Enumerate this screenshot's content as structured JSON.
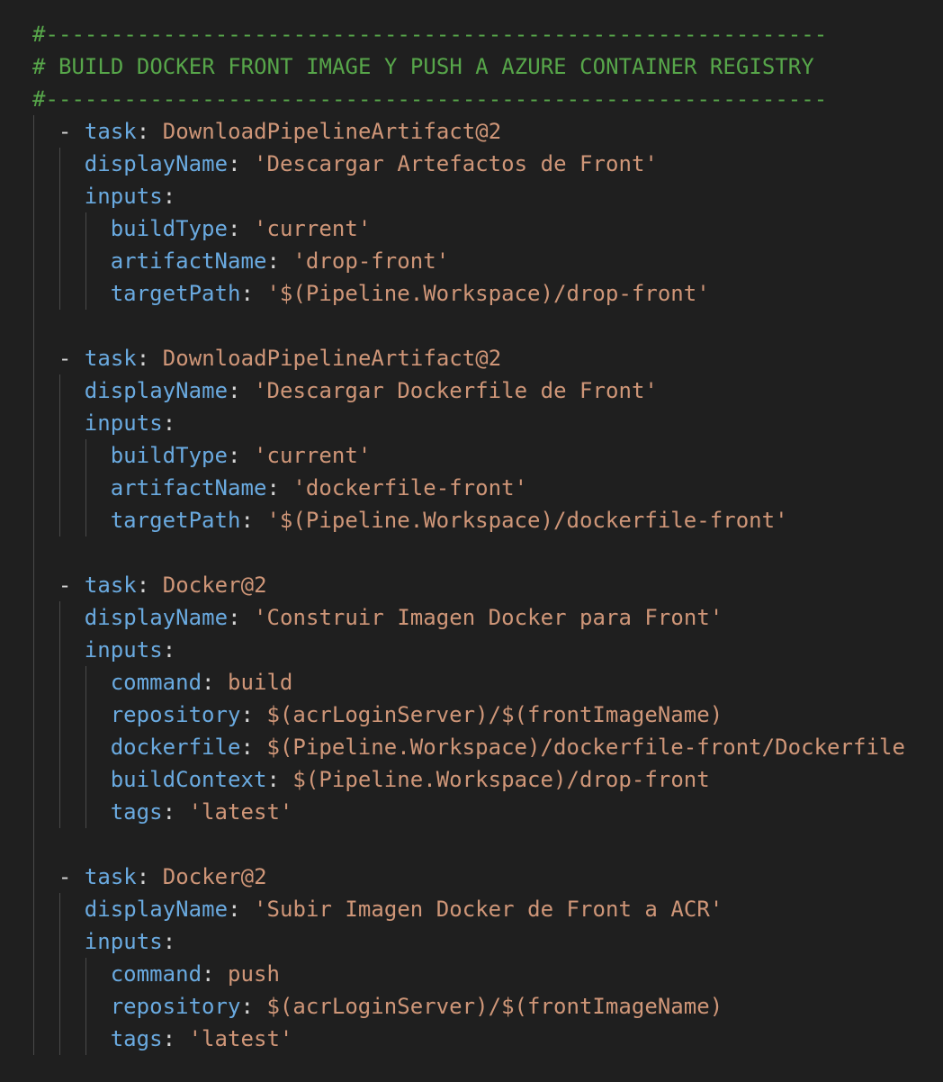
{
  "code": {
    "language": "yaml",
    "lines": [
      {
        "indent": 0,
        "tokens": [
          {
            "t": "#------------------------------------------------------------",
            "c": "cmt"
          }
        ]
      },
      {
        "indent": 0,
        "tokens": [
          {
            "t": "# BUILD DOCKER FRONT IMAGE Y PUSH A AZURE CONTAINER REGISTRY",
            "c": "cmt"
          }
        ]
      },
      {
        "indent": 0,
        "tokens": [
          {
            "t": "#------------------------------------------------------------",
            "c": "cmt"
          }
        ]
      },
      {
        "indent": 2,
        "tokens": [
          {
            "t": "- ",
            "c": "pun"
          },
          {
            "t": "task",
            "c": "key"
          },
          {
            "t": ": ",
            "c": "pun"
          },
          {
            "t": "DownloadPipelineArtifact@2",
            "c": "str"
          }
        ]
      },
      {
        "indent": 4,
        "tokens": [
          {
            "t": "displayName",
            "c": "key"
          },
          {
            "t": ": ",
            "c": "pun"
          },
          {
            "t": "'Descargar Artefactos de Front'",
            "c": "str"
          }
        ]
      },
      {
        "indent": 4,
        "tokens": [
          {
            "t": "inputs",
            "c": "key"
          },
          {
            "t": ":",
            "c": "pun"
          }
        ]
      },
      {
        "indent": 6,
        "tokens": [
          {
            "t": "buildType",
            "c": "key"
          },
          {
            "t": ": ",
            "c": "pun"
          },
          {
            "t": "'current'",
            "c": "str"
          }
        ]
      },
      {
        "indent": 6,
        "tokens": [
          {
            "t": "artifactName",
            "c": "key"
          },
          {
            "t": ": ",
            "c": "pun"
          },
          {
            "t": "'drop-front'",
            "c": "str"
          }
        ]
      },
      {
        "indent": 6,
        "tokens": [
          {
            "t": "targetPath",
            "c": "key"
          },
          {
            "t": ": ",
            "c": "pun"
          },
          {
            "t": "'$(Pipeline.Workspace)/drop-front'",
            "c": "str"
          }
        ]
      },
      {
        "indent": 0,
        "tokens": []
      },
      {
        "indent": 2,
        "tokens": [
          {
            "t": "- ",
            "c": "pun"
          },
          {
            "t": "task",
            "c": "key"
          },
          {
            "t": ": ",
            "c": "pun"
          },
          {
            "t": "DownloadPipelineArtifact@2",
            "c": "str"
          }
        ]
      },
      {
        "indent": 4,
        "tokens": [
          {
            "t": "displayName",
            "c": "key"
          },
          {
            "t": ": ",
            "c": "pun"
          },
          {
            "t": "'Descargar Dockerfile de Front'",
            "c": "str"
          }
        ]
      },
      {
        "indent": 4,
        "tokens": [
          {
            "t": "inputs",
            "c": "key"
          },
          {
            "t": ":",
            "c": "pun"
          }
        ]
      },
      {
        "indent": 6,
        "tokens": [
          {
            "t": "buildType",
            "c": "key"
          },
          {
            "t": ": ",
            "c": "pun"
          },
          {
            "t": "'current'",
            "c": "str"
          }
        ]
      },
      {
        "indent": 6,
        "tokens": [
          {
            "t": "artifactName",
            "c": "key"
          },
          {
            "t": ": ",
            "c": "pun"
          },
          {
            "t": "'dockerfile-front'",
            "c": "str"
          }
        ]
      },
      {
        "indent": 6,
        "tokens": [
          {
            "t": "targetPath",
            "c": "key"
          },
          {
            "t": ": ",
            "c": "pun"
          },
          {
            "t": "'$(Pipeline.Workspace)/dockerfile-front'",
            "c": "str"
          }
        ]
      },
      {
        "indent": 0,
        "tokens": []
      },
      {
        "indent": 2,
        "tokens": [
          {
            "t": "- ",
            "c": "pun"
          },
          {
            "t": "task",
            "c": "key"
          },
          {
            "t": ": ",
            "c": "pun"
          },
          {
            "t": "Docker@2",
            "c": "str"
          }
        ]
      },
      {
        "indent": 4,
        "tokens": [
          {
            "t": "displayName",
            "c": "key"
          },
          {
            "t": ": ",
            "c": "pun"
          },
          {
            "t": "'Construir Imagen Docker para Front'",
            "c": "str"
          }
        ]
      },
      {
        "indent": 4,
        "tokens": [
          {
            "t": "inputs",
            "c": "key"
          },
          {
            "t": ":",
            "c": "pun"
          }
        ]
      },
      {
        "indent": 6,
        "tokens": [
          {
            "t": "command",
            "c": "key"
          },
          {
            "t": ": ",
            "c": "pun"
          },
          {
            "t": "build",
            "c": "str"
          }
        ]
      },
      {
        "indent": 6,
        "tokens": [
          {
            "t": "repository",
            "c": "key"
          },
          {
            "t": ": ",
            "c": "pun"
          },
          {
            "t": "$(acrLoginServer)/$(frontImageName)",
            "c": "str"
          }
        ]
      },
      {
        "indent": 6,
        "tokens": [
          {
            "t": "dockerfile",
            "c": "key"
          },
          {
            "t": ": ",
            "c": "pun"
          },
          {
            "t": "$(Pipeline.Workspace)/dockerfile-front/Dockerfile",
            "c": "str"
          }
        ]
      },
      {
        "indent": 6,
        "tokens": [
          {
            "t": "buildContext",
            "c": "key"
          },
          {
            "t": ": ",
            "c": "pun"
          },
          {
            "t": "$(Pipeline.Workspace)/drop-front",
            "c": "str"
          }
        ]
      },
      {
        "indent": 6,
        "tokens": [
          {
            "t": "tags",
            "c": "key"
          },
          {
            "t": ": ",
            "c": "pun"
          },
          {
            "t": "'latest'",
            "c": "str"
          }
        ]
      },
      {
        "indent": 0,
        "tokens": []
      },
      {
        "indent": 2,
        "tokens": [
          {
            "t": "- ",
            "c": "pun"
          },
          {
            "t": "task",
            "c": "key"
          },
          {
            "t": ": ",
            "c": "pun"
          },
          {
            "t": "Docker@2",
            "c": "str"
          }
        ]
      },
      {
        "indent": 4,
        "tokens": [
          {
            "t": "displayName",
            "c": "key"
          },
          {
            "t": ": ",
            "c": "pun"
          },
          {
            "t": "'Subir Imagen Docker de Front a ACR'",
            "c": "str"
          }
        ]
      },
      {
        "indent": 4,
        "tokens": [
          {
            "t": "inputs",
            "c": "key"
          },
          {
            "t": ":",
            "c": "pun"
          }
        ]
      },
      {
        "indent": 6,
        "tokens": [
          {
            "t": "command",
            "c": "key"
          },
          {
            "t": ": ",
            "c": "pun"
          },
          {
            "t": "push",
            "c": "str"
          }
        ]
      },
      {
        "indent": 6,
        "tokens": [
          {
            "t": "repository",
            "c": "key"
          },
          {
            "t": ": ",
            "c": "pun"
          },
          {
            "t": "$(acrLoginServer)/$(frontImageName)",
            "c": "str"
          }
        ]
      },
      {
        "indent": 6,
        "tokens": [
          {
            "t": "tags",
            "c": "key"
          },
          {
            "t": ": ",
            "c": "pun"
          },
          {
            "t": "'latest'",
            "c": "str"
          }
        ]
      }
    ]
  },
  "colors": {
    "background": "#1f1f1f",
    "comment": "#57a64a",
    "key": "#6aaae0",
    "string": "#cf9678",
    "punctuation": "#d4d4d4",
    "indent_guide": "#4a4a4a"
  }
}
